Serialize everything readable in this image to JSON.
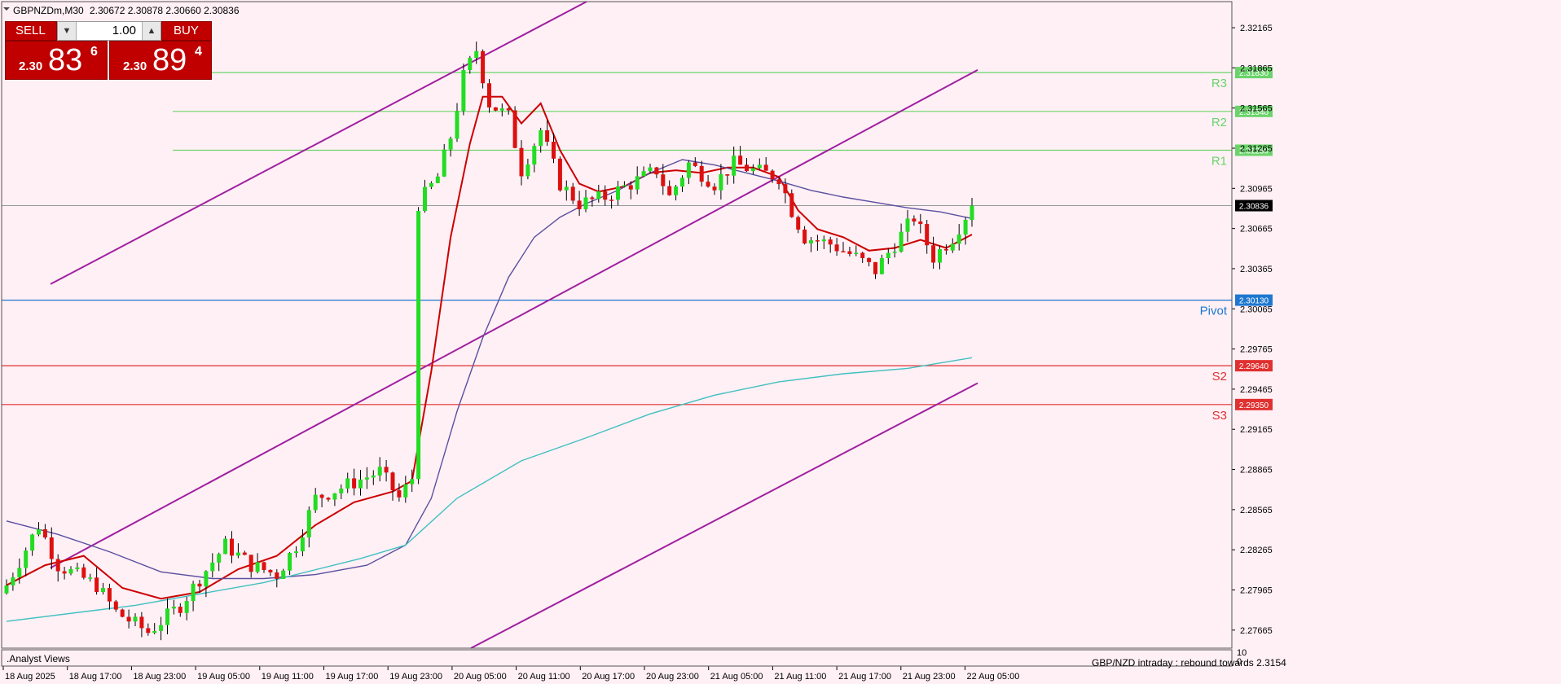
{
  "header": {
    "symbol_tf": "GBPNZDm,M30",
    "ohlc": "2.30672 2.30878 2.30660 2.30836"
  },
  "trade_panel": {
    "sell_label": "SELL",
    "buy_label": "BUY",
    "lot": "1.00",
    "sell_prefix": "2.30",
    "sell_big": "83",
    "sell_sup": "6",
    "buy_prefix": "2.30",
    "buy_big": "89",
    "buy_sup": "4"
  },
  "indicator_window": {
    "title": ".Analyst Views",
    "text": "GBP/NZD intraday :   rebound towards 2.3154",
    "scale_top": "10",
    "scale_bottom": "0"
  },
  "colors": {
    "background": "#fff0f5",
    "bull": "#22dd22",
    "bear": "#dd1010",
    "ma_fast": "#cc0000",
    "ma_mid": "#5a4fa0",
    "ma_slow": "#40c0c0",
    "channel": "#a020a0",
    "resistance": "#6ad46a",
    "pivot": "#1e78d0",
    "support": "#e03030",
    "current": "#999999"
  },
  "chart_data": {
    "type": "candlestick",
    "timeframe": "M30",
    "ylim": [
      2.2753,
      2.3236
    ],
    "y_ticks": [
      "2.32165",
      "2.31865",
      "2.31565",
      "2.31265",
      "2.30965",
      "2.30665",
      "2.30365",
      "2.30065",
      "2.29765",
      "2.29465",
      "2.29165",
      "2.28865",
      "2.28565",
      "2.28265",
      "2.27965",
      "2.27665"
    ],
    "x_tick_labels": [
      "18 Aug 2025",
      "18 Aug 17:00",
      "18 Aug 23:00",
      "19 Aug 05:00",
      "19 Aug 11:00",
      "19 Aug 17:00",
      "19 Aug 23:00",
      "20 Aug 05:00",
      "20 Aug 11:00",
      "20 Aug 17:00",
      "20 Aug 23:00",
      "21 Aug 05:00",
      "21 Aug 11:00",
      "21 Aug 17:00",
      "21 Aug 23:00",
      "22 Aug 05:00"
    ],
    "levels": [
      {
        "name": "R3",
        "value": 2.3183,
        "label": "2.31830"
      },
      {
        "name": "R2",
        "value": 2.3154,
        "label": "2.31540"
      },
      {
        "name": "R1",
        "value": 2.3125,
        "label": "2.31250"
      },
      {
        "name": "Pivot",
        "value": 2.3013,
        "label": "2.30130"
      },
      {
        "name": "S2",
        "value": 2.2964,
        "label": "2.29640"
      },
      {
        "name": "S3",
        "value": 2.2935,
        "label": "2.29350"
      }
    ],
    "current_price": {
      "value": 2.30836,
      "label": "2.30836"
    },
    "channel_upper": [
      [
        0,
        2.3025
      ],
      [
        85,
        2.3236
      ]
    ],
    "channel_middle_start": [
      [
        0,
        2.2813
      ],
      [
        150,
        2.3185
      ]
    ],
    "channel_lower": [
      [
        73,
        2.2753
      ],
      [
        150,
        2.2951
      ]
    ],
    "series": [
      {
        "name": "",
        "type": "candles",
        "waypoints": [
          [
            0,
            2.28
          ],
          [
            5,
            2.2845
          ],
          [
            8,
            2.2815
          ],
          [
            14,
            2.28
          ],
          [
            17,
            2.278
          ],
          [
            22,
            2.2765
          ],
          [
            27,
            2.2785
          ],
          [
            30,
            2.2805
          ],
          [
            34,
            2.283
          ],
          [
            38,
            2.2815
          ],
          [
            42,
            2.2808
          ],
          [
            45,
            2.283
          ],
          [
            48,
            2.2865
          ],
          [
            53,
            2.2875
          ],
          [
            58,
            2.2885
          ],
          [
            61,
            2.2865
          ],
          [
            63,
            2.288
          ],
          [
            64,
            2.3085
          ],
          [
            67,
            2.3105
          ],
          [
            69,
            2.3135
          ],
          [
            71,
            2.318
          ],
          [
            73,
            2.32
          ],
          [
            75,
            2.316
          ],
          [
            78,
            2.315
          ],
          [
            80,
            2.311
          ],
          [
            83,
            2.314
          ],
          [
            86,
            2.31
          ],
          [
            89,
            2.3085
          ],
          [
            93,
            2.309
          ],
          [
            97,
            2.31
          ],
          [
            101,
            2.311
          ],
          [
            103,
            2.309
          ],
          [
            106,
            2.3115
          ],
          [
            110,
            2.31
          ],
          [
            113,
            2.3115
          ],
          [
            116,
            2.311
          ],
          [
            120,
            2.3105
          ],
          [
            122,
            2.308
          ],
          [
            124,
            2.306
          ],
          [
            128,
            2.3055
          ],
          [
            132,
            2.3045
          ],
          [
            135,
            2.3035
          ],
          [
            138,
            2.3055
          ],
          [
            141,
            2.3075
          ],
          [
            144,
            2.3045
          ],
          [
            147,
            2.306
          ],
          [
            150,
            2.3084
          ]
        ]
      },
      {
        "name": "",
        "type": "line",
        "role": "ma_fast",
        "points": [
          [
            0,
            2.28
          ],
          [
            6,
            2.2815
          ],
          [
            12,
            2.2822
          ],
          [
            18,
            2.2798
          ],
          [
            24,
            2.279
          ],
          [
            30,
            2.2795
          ],
          [
            36,
            2.2812
          ],
          [
            42,
            2.2822
          ],
          [
            48,
            2.2845
          ],
          [
            54,
            2.2862
          ],
          [
            60,
            2.287
          ],
          [
            63,
            2.2878
          ],
          [
            66,
            2.296
          ],
          [
            69,
            2.306
          ],
          [
            72,
            2.313
          ],
          [
            74,
            2.3165
          ],
          [
            77,
            2.3165
          ],
          [
            80,
            2.3145
          ],
          [
            83,
            2.316
          ],
          [
            86,
            2.3125
          ],
          [
            89,
            2.31
          ],
          [
            92,
            2.3094
          ],
          [
            96,
            2.3098
          ],
          [
            100,
            2.3108
          ],
          [
            104,
            2.311
          ],
          [
            108,
            2.3108
          ],
          [
            112,
            2.3112
          ],
          [
            116,
            2.3112
          ],
          [
            120,
            2.3105
          ],
          [
            123,
            2.308
          ],
          [
            126,
            2.3066
          ],
          [
            130,
            2.306
          ],
          [
            134,
            2.305
          ],
          [
            138,
            2.3052
          ],
          [
            142,
            2.3058
          ],
          [
            146,
            2.3052
          ],
          [
            150,
            2.3062
          ]
        ]
      },
      {
        "name": "",
        "type": "line",
        "role": "ma_mid",
        "points": [
          [
            0,
            2.2848
          ],
          [
            8,
            2.2838
          ],
          [
            16,
            2.2825
          ],
          [
            24,
            2.281
          ],
          [
            32,
            2.2805
          ],
          [
            40,
            2.2805
          ],
          [
            48,
            2.2808
          ],
          [
            56,
            2.2815
          ],
          [
            62,
            2.283
          ],
          [
            66,
            2.2865
          ],
          [
            70,
            2.293
          ],
          [
            74,
            2.2985
          ],
          [
            78,
            2.303
          ],
          [
            82,
            2.306
          ],
          [
            86,
            2.3075
          ],
          [
            90,
            2.3085
          ],
          [
            95,
            2.3095
          ],
          [
            100,
            2.3108
          ],
          [
            105,
            2.3118
          ],
          [
            110,
            2.3114
          ],
          [
            115,
            2.3108
          ],
          [
            120,
            2.3102
          ],
          [
            125,
            2.3095
          ],
          [
            130,
            2.309
          ],
          [
            135,
            2.3086
          ],
          [
            140,
            2.3082
          ],
          [
            145,
            2.3079
          ],
          [
            150,
            2.3074
          ]
        ]
      },
      {
        "name": "",
        "type": "line",
        "role": "ma_slow",
        "points": [
          [
            0,
            2.2773
          ],
          [
            20,
            2.2785
          ],
          [
            40,
            2.2802
          ],
          [
            55,
            2.282
          ],
          [
            62,
            2.283
          ],
          [
            70,
            2.2865
          ],
          [
            80,
            2.2893
          ],
          [
            90,
            2.291
          ],
          [
            100,
            2.2928
          ],
          [
            110,
            2.2942
          ],
          [
            120,
            2.2952
          ],
          [
            130,
            2.2958
          ],
          [
            140,
            2.2962
          ],
          [
            150,
            2.297
          ]
        ]
      }
    ]
  }
}
